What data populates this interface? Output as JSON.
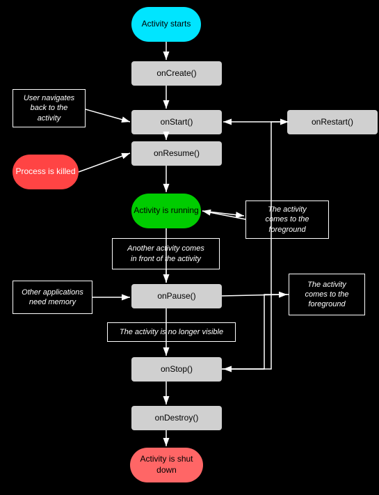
{
  "nodes": {
    "activity_starts": "Activity\nstarts",
    "on_create": "onCreate()",
    "on_start": "onStart()",
    "on_restart": "onRestart()",
    "on_resume": "onResume()",
    "activity_running": "Activity is\nrunning",
    "on_pause": "onPause()",
    "on_stop": "onStop()",
    "on_destroy": "onDestroy()",
    "activity_shutdown": "Activity is\nshut down",
    "process_killed": "Process is\nkilled"
  },
  "labels": {
    "user_navigates": "User navigates\nback to the\nactivity",
    "another_activity": "Another activity comes\nin front of the activity",
    "no_longer_visible": "The activity is no longer visible",
    "foreground_1": "The activity\ncomes to the\nforeground",
    "foreground_2": "The activity\ncomes to the\nforeground",
    "other_apps": "Other applications\nneed memory"
  }
}
